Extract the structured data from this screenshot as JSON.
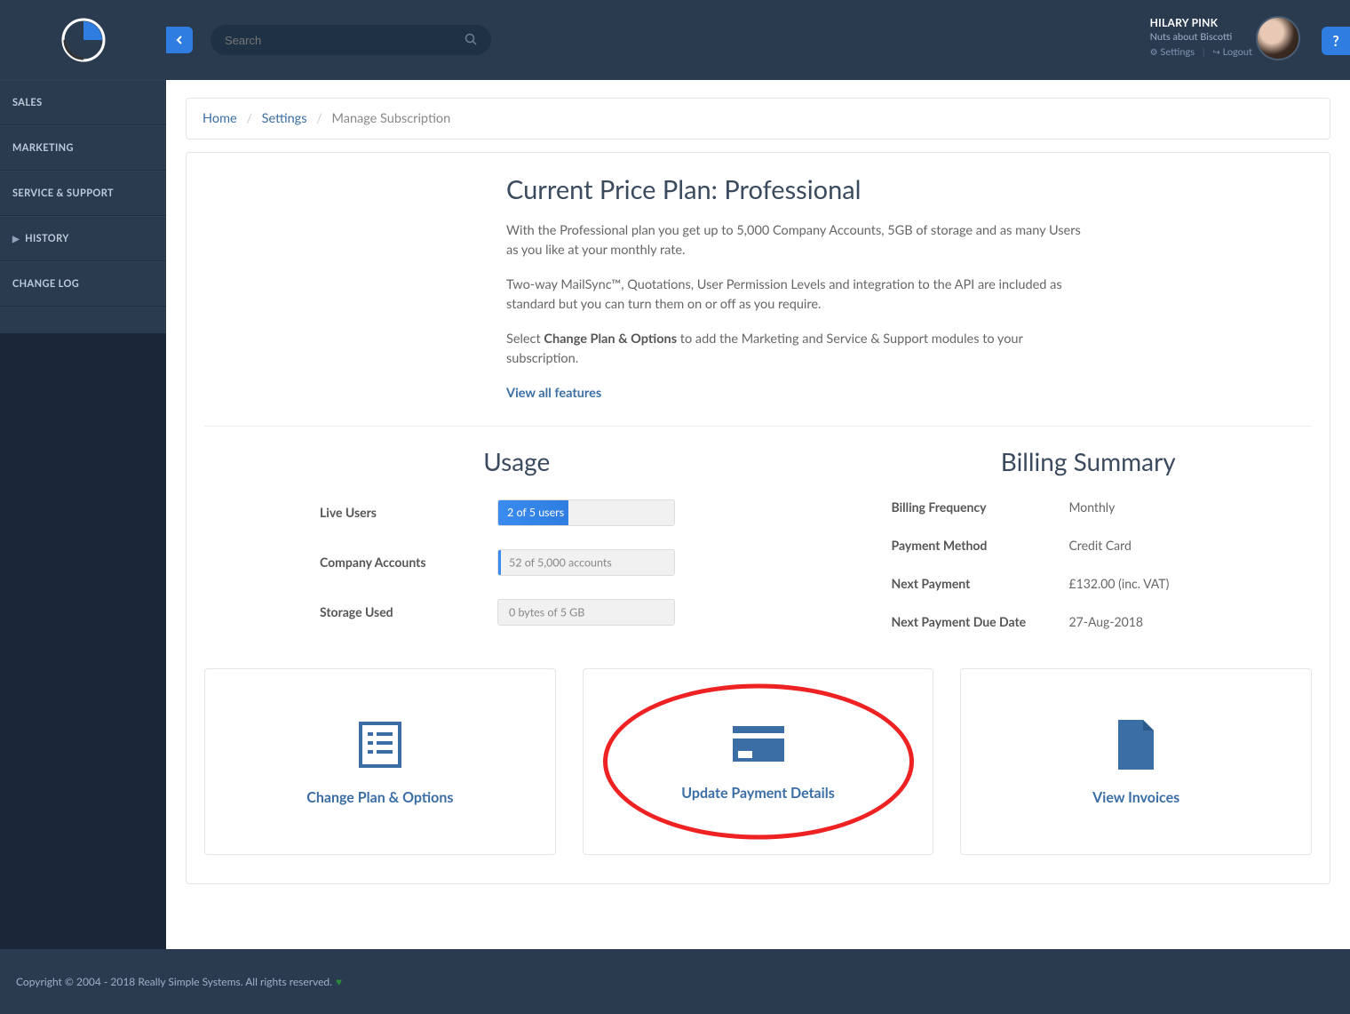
{
  "colors": {
    "accent": "#2f7de1",
    "navy": "#2a3b50"
  },
  "sidebar": {
    "items": [
      {
        "label": "SALES"
      },
      {
        "label": "MARKETING"
      },
      {
        "label": "SERVICE & SUPPORT"
      },
      {
        "label": "HISTORY",
        "chevron": true
      },
      {
        "label": "CHANGE LOG"
      }
    ]
  },
  "topbar": {
    "search_placeholder": "Search",
    "user_name": "HILARY PINK",
    "user_company": "Nuts about Biscotti",
    "settings_label": "Settings",
    "logout_label": "Logout",
    "help_label": "?"
  },
  "breadcrumb": {
    "home": "Home",
    "settings": "Settings",
    "current": "Manage Subscription"
  },
  "plan": {
    "title": "Current Price Plan: Professional",
    "desc1": "With the Professional plan you get up to 5,000 Company Accounts, 5GB of storage and as many Users as you like at your monthly rate.",
    "desc2": "Two-way MailSync™, Quotations, User Permission Levels and integration to the API are included as standard but you can turn them on or off as you require.",
    "desc3_prefix": "Select ",
    "desc3_bold": "Change Plan & Options",
    "desc3_suffix": " to add the Marketing and Service & Support modules to your subscription.",
    "view_all": "View all features"
  },
  "usage": {
    "title": "Usage",
    "rows": [
      {
        "label": "Live Users",
        "text": "2 of 5 users",
        "pct": 40,
        "filled": true
      },
      {
        "label": "Company Accounts",
        "text": "52 of 5,000 accounts",
        "pct": 1,
        "filled": false
      },
      {
        "label": "Storage Used",
        "text": "0 bytes of 5 GB",
        "pct": 0,
        "filled": false
      }
    ]
  },
  "billing": {
    "title": "Billing Summary",
    "rows": [
      {
        "label": "Billing Frequency",
        "value": "Monthly"
      },
      {
        "label": "Payment Method",
        "value": "Credit Card"
      },
      {
        "label": "Next Payment",
        "value": "£132.00 (inc. VAT)"
      },
      {
        "label": "Next Payment Due Date",
        "value": "27-Aug-2018"
      }
    ]
  },
  "cards": [
    {
      "label": "Change Plan & Options",
      "icon": "list",
      "highlight": false
    },
    {
      "label": "Update Payment Details",
      "icon": "card",
      "highlight": true
    },
    {
      "label": "View Invoices",
      "icon": "file",
      "highlight": false
    }
  ],
  "footer": {
    "text": "Copyright © 2004 - 2018 Really Simple Systems. All rights reserved."
  }
}
